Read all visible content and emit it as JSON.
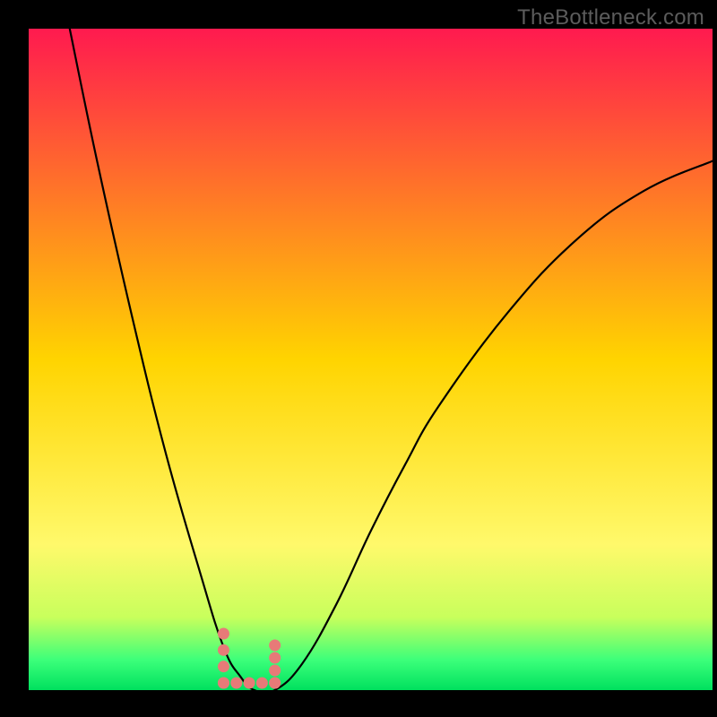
{
  "watermark": "TheBottleneck.com",
  "curve_min_x": 0.33,
  "chart_data": {
    "type": "line",
    "title": "",
    "xlabel": "",
    "ylabel": "",
    "x_range": [
      0,
      1
    ],
    "y_range": [
      0,
      100
    ],
    "series": [
      {
        "name": "bottleneck-curve",
        "x": [
          0.06,
          0.1,
          0.15,
          0.2,
          0.25,
          0.285,
          0.31,
          0.33,
          0.36,
          0.4,
          0.45,
          0.5,
          0.55,
          0.6,
          0.7,
          0.8,
          0.9,
          1.0
        ],
        "y": [
          100.0,
          80.0,
          57.0,
          36.0,
          18.0,
          6.5,
          2.0,
          0.0,
          0.0,
          4.0,
          13.0,
          24.0,
          34.0,
          43.0,
          57.0,
          68.0,
          75.5,
          80.0
        ]
      }
    ],
    "optimal_marker_x": [
      0.285,
      0.36
    ],
    "background_gradient": [
      {
        "stop": 0.0,
        "color": "#ff1a4f"
      },
      {
        "stop": 0.5,
        "color": "#ffd400"
      },
      {
        "stop": 0.78,
        "color": "#fff96b"
      },
      {
        "stop": 0.89,
        "color": "#c8ff5c"
      },
      {
        "stop": 0.955,
        "color": "#3bff7a"
      },
      {
        "stop": 1.0,
        "color": "#00e05e"
      }
    ]
  }
}
